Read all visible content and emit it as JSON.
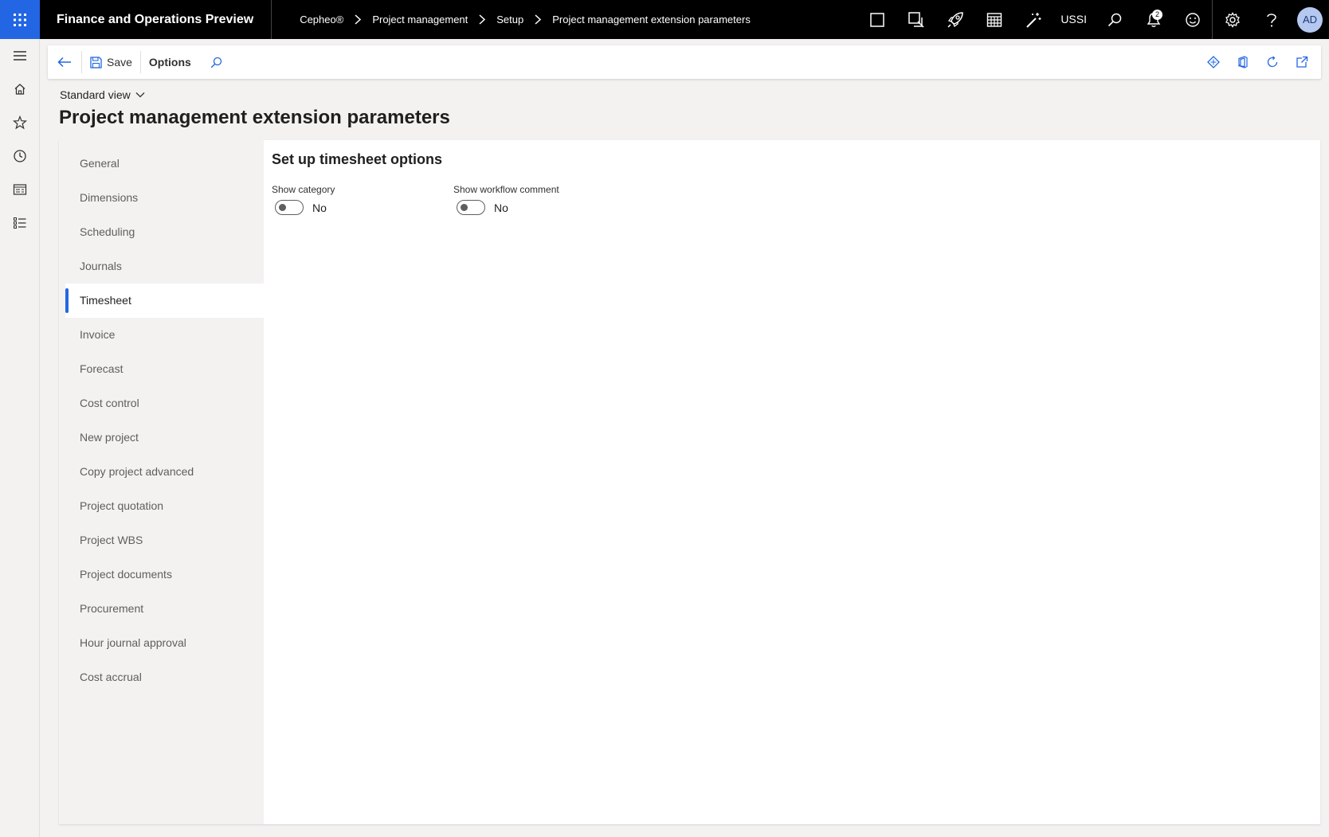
{
  "header": {
    "app_title": "Finance and Operations Preview",
    "breadcrumb": [
      "Cepheo®",
      "Project management",
      "Setup",
      "Project management extension parameters"
    ],
    "company": "USSI",
    "notification_count": "2",
    "avatar_initials": "AD"
  },
  "actionpane": {
    "save_label": "Save",
    "options_label": "Options"
  },
  "view": {
    "selector_label": "Standard view"
  },
  "page": {
    "title": "Project management extension parameters"
  },
  "tabs": [
    {
      "label": "General",
      "active": false
    },
    {
      "label": "Dimensions",
      "active": false
    },
    {
      "label": "Scheduling",
      "active": false
    },
    {
      "label": "Journals",
      "active": false
    },
    {
      "label": "Timesheet",
      "active": true
    },
    {
      "label": "Invoice",
      "active": false
    },
    {
      "label": "Forecast",
      "active": false
    },
    {
      "label": "Cost control",
      "active": false
    },
    {
      "label": "New project",
      "active": false
    },
    {
      "label": "Copy project advanced",
      "active": false
    },
    {
      "label": "Project quotation",
      "active": false
    },
    {
      "label": "Project WBS",
      "active": false
    },
    {
      "label": "Project documents",
      "active": false
    },
    {
      "label": "Procurement",
      "active": false
    },
    {
      "label": "Hour journal approval",
      "active": false
    },
    {
      "label": "Cost accrual",
      "active": false
    }
  ],
  "panel": {
    "title": "Set up timesheet options",
    "fields": [
      {
        "label": "Show category",
        "value": "No"
      },
      {
        "label": "Show workflow comment",
        "value": "No"
      }
    ]
  },
  "colors": {
    "accent": "#2266e3",
    "topbar": "#000000"
  }
}
